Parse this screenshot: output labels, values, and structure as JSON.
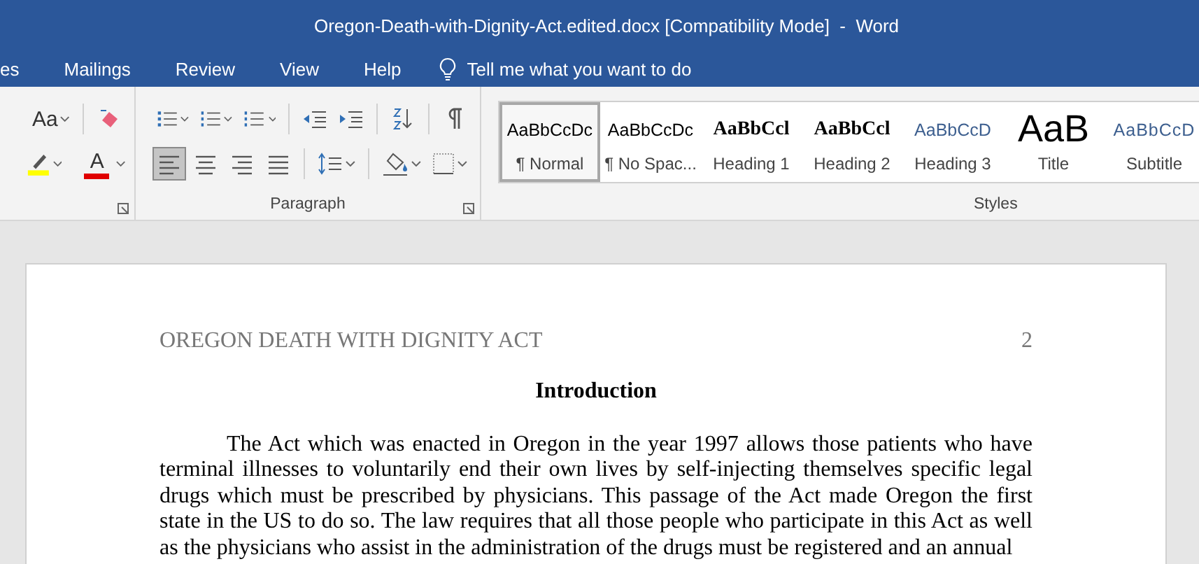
{
  "window": {
    "title": "Oregon-Death-with-Dignity-Act.edited.docx [Compatibility Mode]  -  Word"
  },
  "tabs": [
    {
      "label": "es",
      "selected": false
    },
    {
      "label": "Mailings",
      "selected": false
    },
    {
      "label": "Review",
      "selected": false
    },
    {
      "label": "View",
      "selected": false
    },
    {
      "label": "Help",
      "selected": false
    }
  ],
  "tell_me": {
    "placeholder": "Tell me what you want to do"
  },
  "font_group": {
    "change_case": "Aa",
    "font_color": "A"
  },
  "paragraph_group": {
    "label": "Paragraph",
    "alignment": [
      {
        "kind": "left",
        "selected": true
      },
      {
        "kind": "center",
        "selected": false
      },
      {
        "kind": "right",
        "selected": false
      },
      {
        "kind": "justify",
        "selected": false
      }
    ]
  },
  "styles_group": {
    "label": "Styles",
    "styles": [
      {
        "kind": "normal",
        "preview": "AaBbCcDc",
        "label": "¶ Normal",
        "selected": true
      },
      {
        "kind": "normal",
        "preview": "AaBbCcDc",
        "label": "¶ No Spac...",
        "selected": false
      },
      {
        "kind": "heading1",
        "preview": "AaBbCcl",
        "label": "Heading 1",
        "selected": false
      },
      {
        "kind": "heading2",
        "preview": "AaBbCcl",
        "label": "Heading 2",
        "selected": false
      },
      {
        "kind": "heading3",
        "preview": "AaBbCcD",
        "label": "Heading 3",
        "selected": false
      },
      {
        "kind": "title",
        "preview": "AaB",
        "label": "Title",
        "selected": false
      },
      {
        "kind": "subtitle",
        "preview": "AaBbCcD",
        "label": "Subtitle",
        "selected": false
      }
    ]
  },
  "document": {
    "running_head": "OREGON DEATH WITH DIGNITY ACT",
    "page_number": "2",
    "heading": "Introduction",
    "paragraph": "The Act which was enacted in Oregon in the year 1997 allows those patients who have terminal illnesses to voluntarily end their own lives by self-injecting themselves specific legal drugs which must be prescribed by physicians. This passage of the Act made Oregon the first state in the US to do so. The law requires that all those people who participate in this Act as well as the physicians who assist in the administration of the drugs must be registered and an annual"
  }
}
